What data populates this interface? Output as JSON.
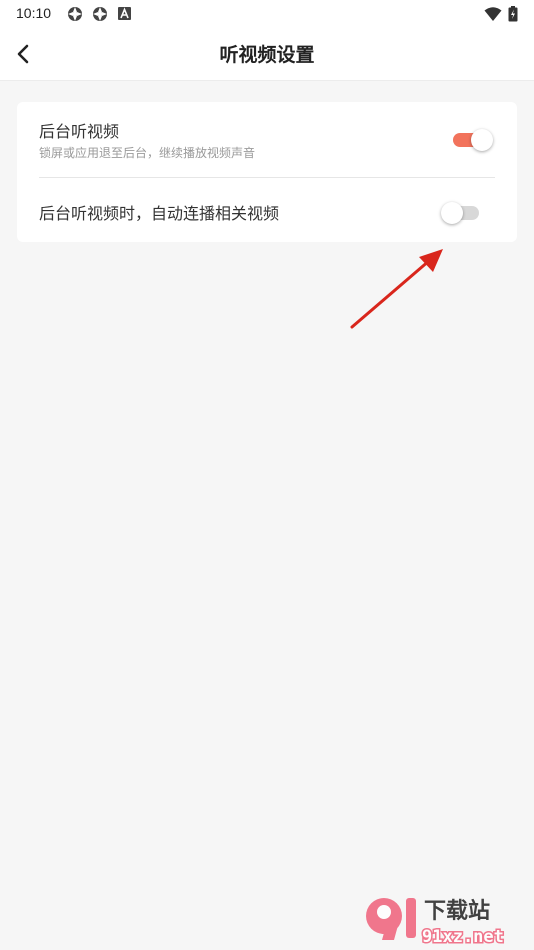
{
  "status_bar": {
    "time": "10:10",
    "icons_left": [
      "sync-icon",
      "sync-icon",
      "android-a-icon"
    ],
    "icons_right": [
      "wifi-icon",
      "battery-charging-icon"
    ]
  },
  "header": {
    "title": "听视频设置",
    "back_icon": "chevron-left-icon"
  },
  "settings": {
    "items": [
      {
        "title": "后台听视频",
        "subtitle": "锁屏或应用退至后台，继续播放视频声音",
        "enabled": true
      },
      {
        "title": "后台听视频时，自动连播相关视频",
        "enabled": false
      }
    ]
  },
  "colors": {
    "accent": "#f2735c",
    "toggle_off": "#d8d8d8",
    "background": "#f6f6f6",
    "card": "#ffffff",
    "annotation_arrow": "#d9261c"
  },
  "watermark": {
    "brand": "下载站",
    "domain": "91xz.net"
  }
}
